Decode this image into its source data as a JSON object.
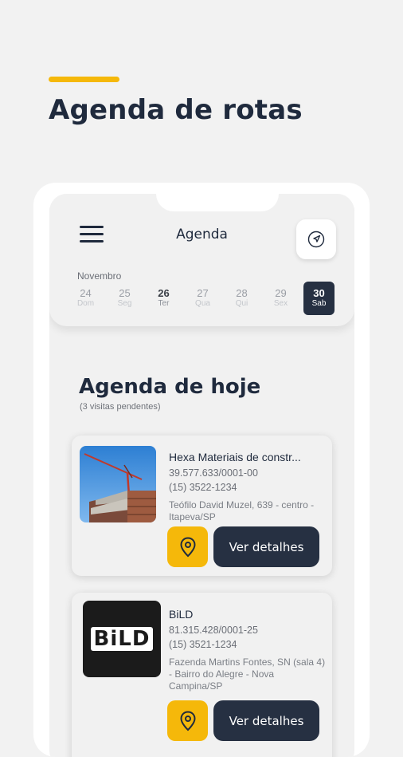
{
  "promo": {
    "title": "Agenda de rotas"
  },
  "header": {
    "title": "Agenda",
    "month": "Novembro",
    "days": [
      {
        "num": "24",
        "weekday": "Dom",
        "state": "normal"
      },
      {
        "num": "25",
        "weekday": "Seg",
        "state": "normal"
      },
      {
        "num": "26",
        "weekday": "Ter",
        "state": "today"
      },
      {
        "num": "27",
        "weekday": "Qua",
        "state": "normal"
      },
      {
        "num": "28",
        "weekday": "Qui",
        "state": "normal"
      },
      {
        "num": "29",
        "weekday": "Sex",
        "state": "normal"
      },
      {
        "num": "30",
        "weekday": "Sab",
        "state": "selected"
      }
    ]
  },
  "today": {
    "title": "Agenda de hoje",
    "subtitle": "(3 visitas pendentes)"
  },
  "visits": [
    {
      "name": "Hexa Materiais de constr...",
      "cnpj": "39.577.633/0001-00",
      "phone": "(15) 3522-1234",
      "address": "Teófilo David Muzel, 639 - centro - Itapeva/SP",
      "details_label": "Ver detalhes"
    },
    {
      "name": "BiLD",
      "logo_text": "BiLD",
      "cnpj": "81.315.428/0001-25",
      "phone": "(15) 3521-1234",
      "address": "Fazenda Martins Fontes, SN (sala 4) - Bairro do Alegre - Nova Campina/SP",
      "details_label": "Ver detalhes"
    }
  ],
  "colors": {
    "accent": "#f5b80a",
    "navy": "#263042",
    "title": "#1f2a3d"
  },
  "icons": {
    "menu": "menu-icon",
    "navigation": "navigation-arrow-icon",
    "pin": "map-pin-icon"
  }
}
